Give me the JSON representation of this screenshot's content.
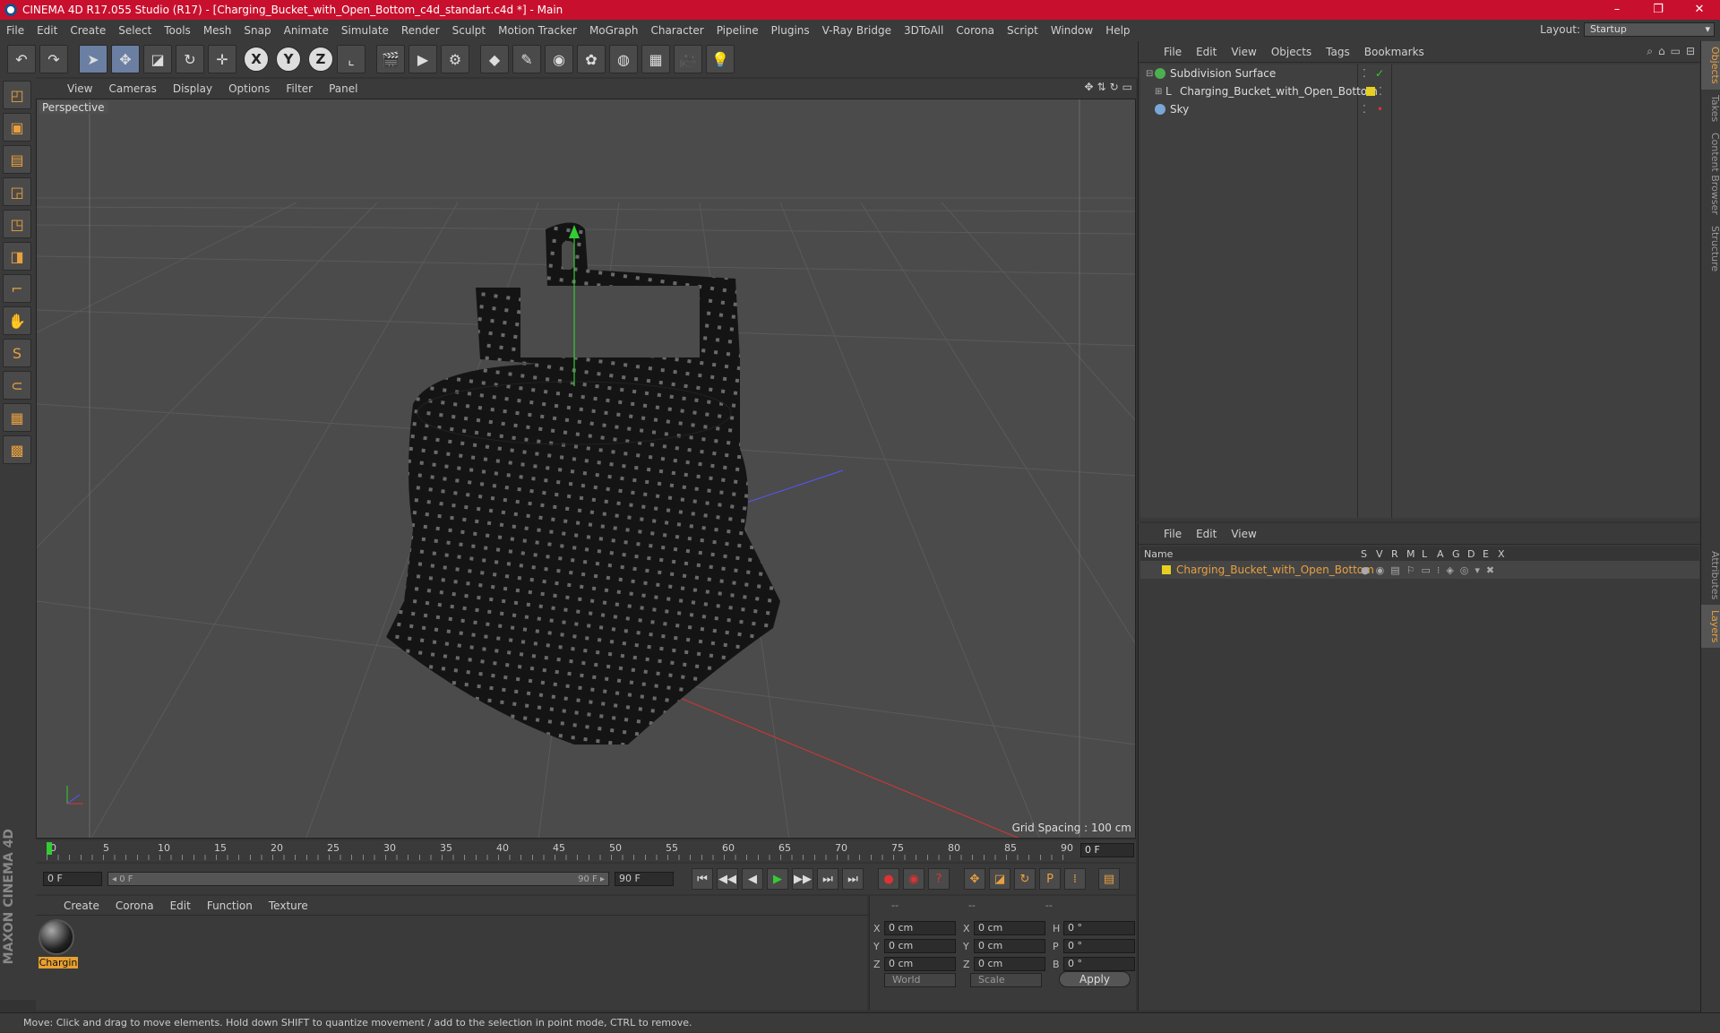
{
  "window": {
    "title": "CINEMA 4D R17.055 Studio (R17) - [Charging_Bucket_with_Open_Bottom_c4d_standart.c4d *] - Main",
    "controls": [
      "–",
      "❐",
      "✕"
    ]
  },
  "menu": [
    "File",
    "Edit",
    "Create",
    "Select",
    "Tools",
    "Mesh",
    "Snap",
    "Animate",
    "Simulate",
    "Render",
    "Sculpt",
    "Motion Tracker",
    "MoGraph",
    "Character",
    "Pipeline",
    "Plugins",
    "V-Ray Bridge",
    "3DToAll",
    "Corona",
    "Script",
    "Window",
    "Help"
  ],
  "layout": {
    "label": "Layout:",
    "value": "Startup"
  },
  "toolbar": {
    "undo": "↶",
    "redo": "↷",
    "select": "➤",
    "move": "✥",
    "scale": "◪",
    "rotate": "↻",
    "move2": "✛",
    "axis_x": "X",
    "axis_y": "Y",
    "axis_z": "Z",
    "coord": "⌞",
    "render_view": "🎬",
    "render": "▶",
    "render_settings": "⚙",
    "cube": "◆",
    "pen": "✎",
    "subdiv": "◉",
    "cloner": "✿",
    "deformer": "◍",
    "floor": "▦",
    "camera": "🎥",
    "light": "💡"
  },
  "left_tools": [
    "◰",
    "▣",
    "▤",
    "◲",
    "◳",
    "◨",
    "⌐",
    "✋",
    "S",
    "⊂",
    "▦",
    "▩"
  ],
  "brand": "MAXON CINEMA 4D",
  "viewport": {
    "menu": [
      "View",
      "Cameras",
      "Display",
      "Options",
      "Filter",
      "Panel"
    ],
    "nav_icons": [
      "✥",
      "⇅",
      "↻",
      "▭"
    ],
    "label": "Perspective",
    "grid_spacing": "Grid Spacing : 100 cm"
  },
  "timeline": {
    "ticks": [
      "0",
      "5",
      "10",
      "15",
      "20",
      "25",
      "30",
      "35",
      "40",
      "45",
      "50",
      "55",
      "60",
      "65",
      "70",
      "75",
      "80",
      "85",
      "90"
    ],
    "current_frame": "0 F"
  },
  "playback": {
    "start": "0 F",
    "range_start": "◂ 0 F",
    "range_end": "90 F ▸",
    "end": "90 F",
    "buttons": [
      "⏮",
      "◀◀",
      "◀",
      "▶",
      "▶▶",
      "⏭",
      "⏭"
    ]
  },
  "material_panel": {
    "menu": [
      "Create",
      "Corona",
      "Edit",
      "Function",
      "Texture"
    ],
    "material_name": "Chargin"
  },
  "coords": {
    "headers": [
      "--",
      "--",
      "--"
    ],
    "rows": [
      {
        "a": "X",
        "a_val": "0 cm",
        "b": "X",
        "b_val": "0 cm",
        "c": "H",
        "c_val": "0 °"
      },
      {
        "a": "Y",
        "a_val": "0 cm",
        "b": "Y",
        "b_val": "0 cm",
        "c": "P",
        "c_val": "0 °"
      },
      {
        "a": "Z",
        "a_val": "0 cm",
        "b": "Z",
        "b_val": "0 cm",
        "c": "B",
        "c_val": "0 °"
      }
    ],
    "mode_world": "World",
    "mode_scale": "Scale",
    "apply": "Apply"
  },
  "status": "Move: Click and drag to move elements. Hold down SHIFT to quantize movement / add to the selection in point mode, CTRL to remove.",
  "objects_panel": {
    "menu": [
      "File",
      "Edit",
      "View",
      "Objects",
      "Tags",
      "Bookmarks"
    ],
    "items": [
      {
        "name": "Subdivision Surface",
        "color": "#4caf50"
      },
      {
        "name": "Charging_Bucket_with_Open_Bottom",
        "color": "#c0c0c0"
      },
      {
        "name": "Sky",
        "color": "#7aa6d8"
      }
    ]
  },
  "layers_panel": {
    "menu": [
      "File",
      "Edit",
      "View"
    ],
    "columns": [
      "Name",
      "S",
      "V",
      "R",
      "M",
      "L",
      "A",
      "G",
      "D",
      "E",
      "X"
    ],
    "layer_name": "Charging_Bucket_with_Open_Bottom"
  },
  "side_tabs": [
    "Objects",
    "Takes",
    "Content Browser",
    "Structure",
    "Attributes",
    "Layers"
  ],
  "colors": {
    "accent": "#e8a040",
    "titlebar": "#c8102e",
    "axis_x": "#d33",
    "axis_y": "#3c3",
    "axis_z": "#55f"
  }
}
